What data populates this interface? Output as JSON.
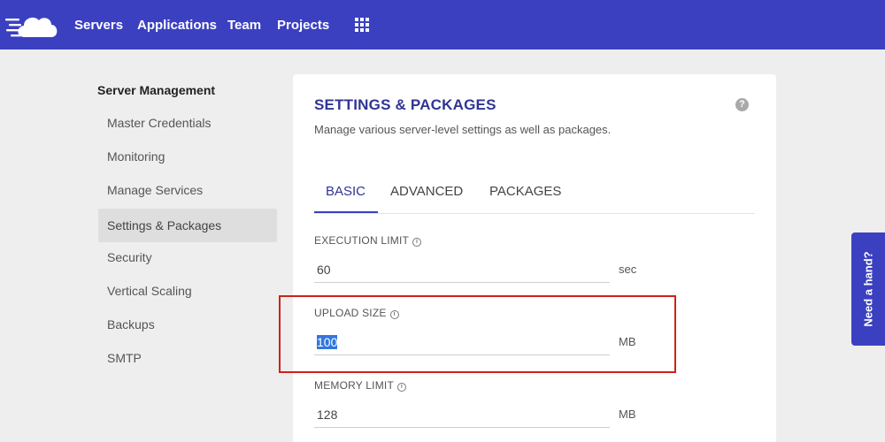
{
  "nav": {
    "items": [
      "Servers",
      "Applications",
      "Team",
      "Projects"
    ]
  },
  "sidebar": {
    "heading": "Server Management",
    "items": [
      {
        "label": "Master Credentials"
      },
      {
        "label": "Monitoring"
      },
      {
        "label": "Manage Services"
      },
      {
        "label": "Settings & Packages",
        "active": true
      },
      {
        "label": "Security"
      },
      {
        "label": "Vertical Scaling"
      },
      {
        "label": "Backups"
      },
      {
        "label": "SMTP"
      }
    ]
  },
  "panel": {
    "title": "SETTINGS & PACKAGES",
    "subtitle": "Manage various server-level settings as well as packages.",
    "help_icon": "?",
    "tabs": [
      "BASIC",
      "ADVANCED",
      "PACKAGES"
    ],
    "active_tab": "BASIC"
  },
  "fields": [
    {
      "label": "EXECUTION LIMIT",
      "value": "60",
      "unit": "sec"
    },
    {
      "label": "UPLOAD SIZE",
      "value": "100",
      "unit": "MB",
      "selected": true
    },
    {
      "label": "MEMORY LIMIT",
      "value": "128",
      "unit": "MB"
    }
  ],
  "help_tab": {
    "label": "Need a hand?"
  },
  "icons": {
    "logo": "cloud-logo-icon",
    "apps": "grid-icon",
    "help": "question-icon",
    "info": "info-icon"
  },
  "colors": {
    "brand": "#3b40c1",
    "title": "#2f3593",
    "highlight": "#d0201c"
  }
}
